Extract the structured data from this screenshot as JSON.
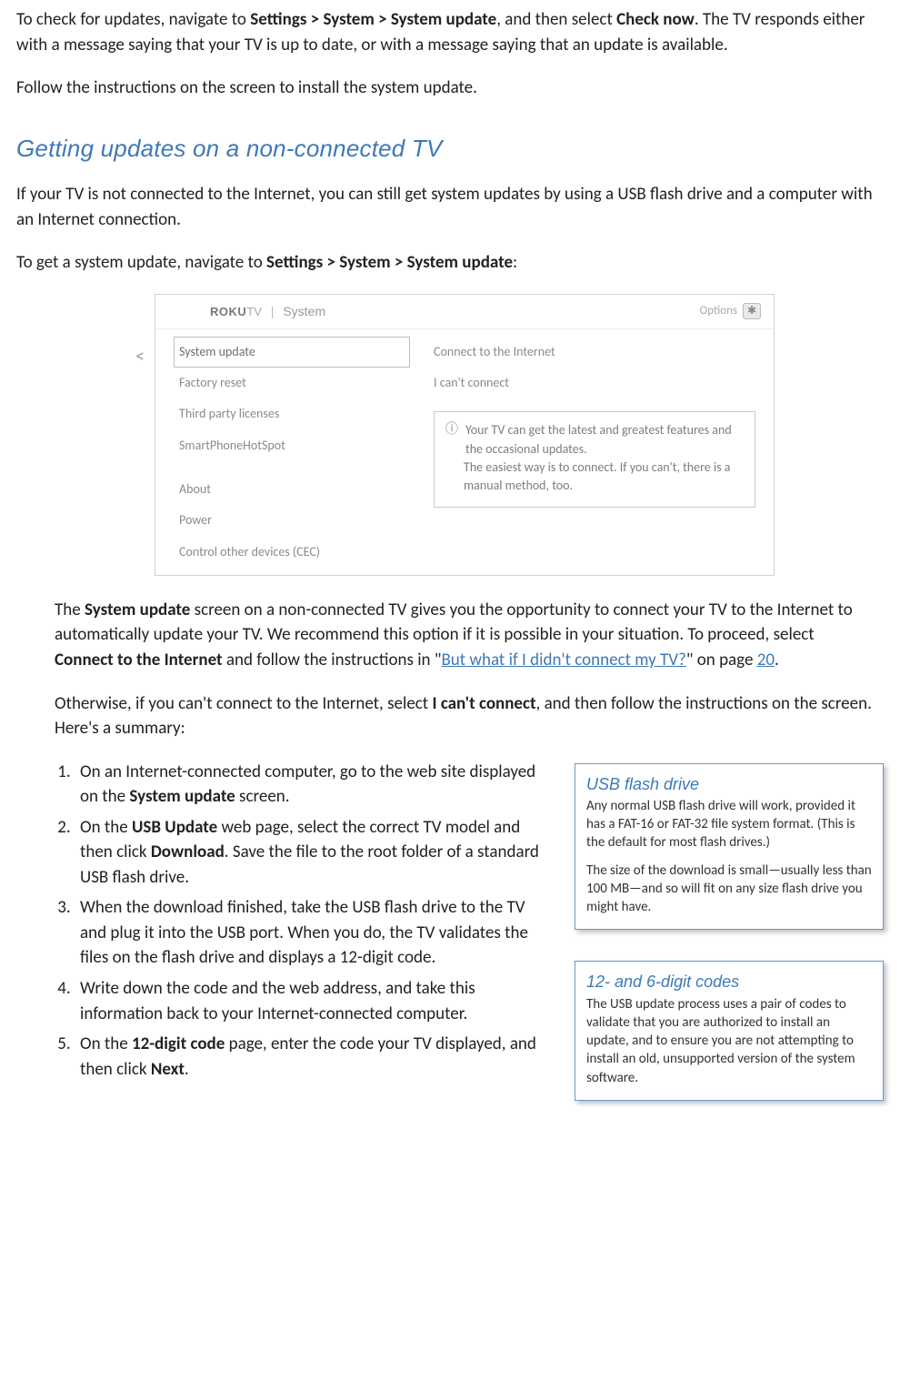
{
  "intro": {
    "p1_a": "To check for updates, navigate to ",
    "p1_nav": "Settings > System > System update",
    "p1_b": ", and then select ",
    "p1_checknow": "Check now",
    "p1_c": ". The TV responds either with a message saying that your TV is up to date, or with a message saying that an update is available.",
    "p2": "Follow the instructions on the screen to install the system update."
  },
  "heading1": "Getting updates on a non-connected TV",
  "nonconn": {
    "p1": "If your TV is not connected to the Internet, you can still get system updates by using a USB flash drive and a computer with an Internet connection.",
    "p2_a": "To get a system update, navigate to ",
    "p2_nav": "Settings > System > System update",
    "p2_b": ":"
  },
  "tvshot": {
    "brand_b": "ROKU",
    "brand_thin": "TV",
    "crumb": "System",
    "options": "Options",
    "back": "<",
    "left": [
      "System update",
      "Factory reset",
      "Third party licenses",
      "SmartPhoneHotSpot",
      "",
      "About",
      "Power",
      "Control other devices (CEC)"
    ],
    "right": [
      "Connect to the Internet",
      "I can't connect"
    ],
    "info_icon": "ⓘ",
    "info1": "Your TV can get the latest and greatest features and the occasional updates.",
    "info2": "The easiest way is to connect. If you can't, there is a manual method, too."
  },
  "after": {
    "p1_a": "The ",
    "p1_sysupdate": "System update",
    "p1_b": " screen on a non-connected TV gives you the opportunity to connect your TV to the Internet to automatically update your TV. We recommend this option if it is possible in your situation. To proceed, select ",
    "p1_connect": "Connect to the Internet",
    "p1_c": " and follow the instructions in \"",
    "p1_link": "But what if I didn't connect my TV?",
    "p1_d": "\" on page ",
    "p1_page": "20",
    "p1_e": ".",
    "p2_a": "Otherwise, if you can't connect to the Internet, select ",
    "p2_icant": "I can't connect",
    "p2_b": ", and then follow the instructions on the screen. Here's a summary:"
  },
  "steps": {
    "s1_a": "On an Internet-connected computer, go to the web site displayed on the ",
    "s1_b": "System update",
    "s1_c": " screen.",
    "s2_a": "On the ",
    "s2_b": "USB Update",
    "s2_c": " web page, select the correct TV model and then click ",
    "s2_d": "Download",
    "s2_e": ". Save the file to the root folder of a standard USB flash drive.",
    "s3": "When the download finished, take the USB flash drive to the TV and plug it into the USB port. When you do, the TV validates the files on the flash drive and displays a 12-digit code.",
    "s4": "Write down the code and the web address, and take this information back to your Internet-connected computer.",
    "s5_a": "On the ",
    "s5_b": "12-digit code",
    "s5_c": " page, enter the code your TV displayed, and then click ",
    "s5_d": "Next",
    "s5_e": "."
  },
  "callout1": {
    "title": "USB flash drive",
    "p1": "Any normal USB flash drive will work, provided it has a FAT-16 or FAT-32 file system format. (This is the default for most flash drives.)",
    "p2": "The size of the download is small—usually less than 100 MB—and so will fit on any size flash drive you might have."
  },
  "callout2": {
    "title": "12- and 6-digit codes",
    "p1": "The USB update process uses a pair of codes to validate that you are authorized to install an update, and to ensure you are not attempting to install an old, unsupported version of the system software."
  }
}
